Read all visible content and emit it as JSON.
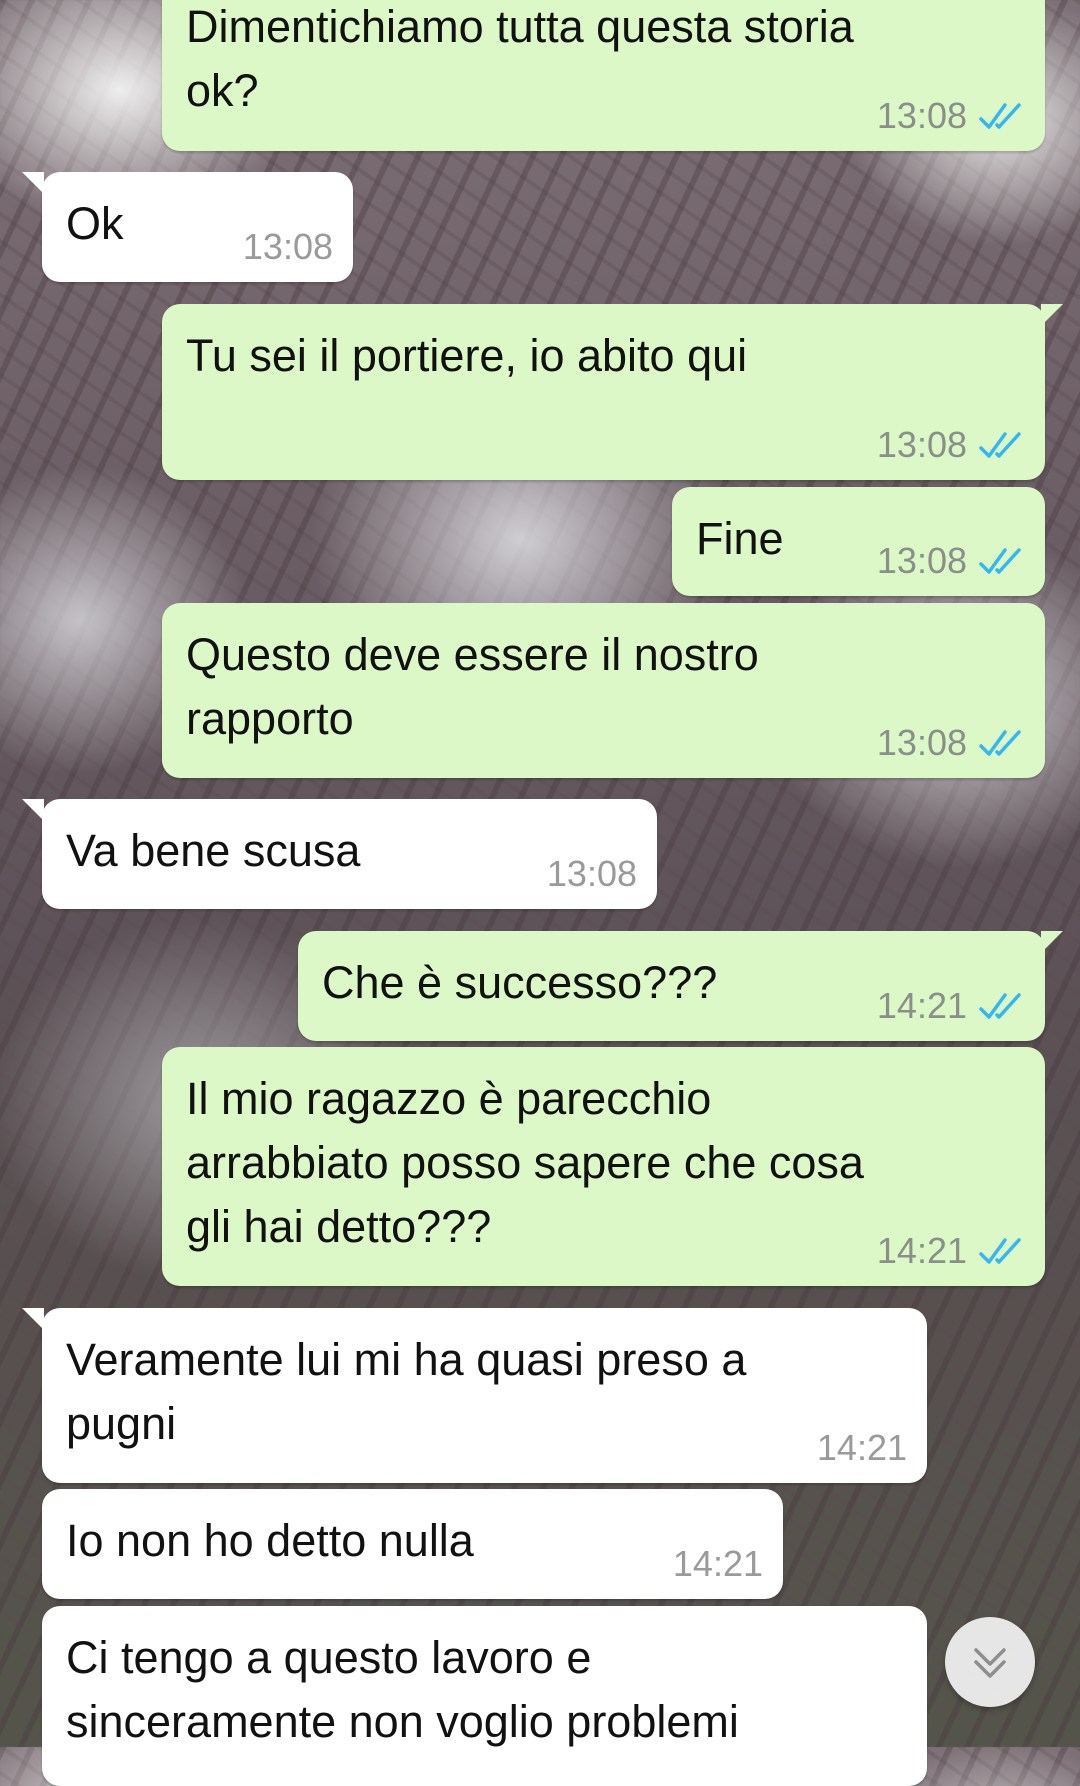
{
  "colors": {
    "outgoing_bubble": "#dcf8c6",
    "incoming_bubble": "#ffffff",
    "read_ticks": "#34b7f1",
    "timestamp": "#8a8f8a"
  },
  "messages": [
    {
      "direction": "outgoing",
      "text": "Dimentichiamo tutta questa storia\nok?",
      "time": "13:08",
      "status_icon": "double-check-read-icon"
    },
    {
      "direction": "incoming",
      "text": "Ok",
      "time": "13:08"
    },
    {
      "direction": "outgoing",
      "text": "Tu sei il portiere, io abito qui",
      "time": "13:08",
      "status_icon": "double-check-read-icon"
    },
    {
      "direction": "outgoing",
      "text": "Fine",
      "time": "13:08",
      "status_icon": "double-check-read-icon"
    },
    {
      "direction": "outgoing",
      "text": "Questo deve essere il nostro\nrapporto",
      "time": "13:08",
      "status_icon": "double-check-read-icon"
    },
    {
      "direction": "incoming",
      "text": "Va bene scusa",
      "time": "13:08"
    },
    {
      "direction": "outgoing",
      "text": "Che è successo???",
      "time": "14:21",
      "status_icon": "double-check-read-icon"
    },
    {
      "direction": "outgoing",
      "text": "Il mio ragazzo è parecchio\narrabbiato posso sapere che cosa\ngli hai detto???",
      "time": "14:21",
      "status_icon": "double-check-read-icon"
    },
    {
      "direction": "incoming",
      "text": "Veramente lui mi ha quasi preso a\npugni",
      "time": "14:21"
    },
    {
      "direction": "incoming",
      "text": "Io non ho detto nulla",
      "time": "14:21"
    },
    {
      "direction": "incoming",
      "text": "Ci tengo a questo lavoro e\nsinceramente non voglio problemi",
      "time": ""
    }
  ],
  "scroll_button": {
    "icon": "double-chevron-down-icon"
  }
}
